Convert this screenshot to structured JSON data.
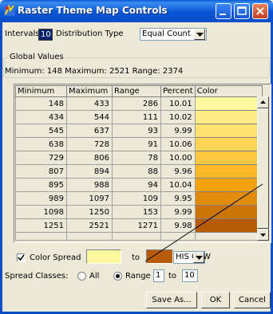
{
  "window": {
    "title": "Raster Theme Map Controls",
    "colors": {
      "titlebar": "#0a5ad6",
      "close_button": "#c3401f"
    }
  },
  "top_controls": {
    "intervals_label": "Intervals",
    "intervals_value": "10",
    "distribution_label": "Distribution Type",
    "distribution_value": "Equal Count"
  },
  "global_values": {
    "group_label": "Global Values",
    "summary": "Minimum: 148  Maximum: 2521  Range: 2374"
  },
  "table": {
    "columns": [
      "Minimum",
      "Maximum",
      "Range",
      "Percent",
      "Color"
    ],
    "rows": [
      {
        "min": "148",
        "max": "433",
        "range": "286",
        "percent": "10.01",
        "color": "#fff8a0"
      },
      {
        "min": "434",
        "max": "544",
        "range": "111",
        "percent": "10.02",
        "color": "#ffee88"
      },
      {
        "min": "545",
        "max": "637",
        "range": "93",
        "percent": "9.99",
        "color": "#ffe270"
      },
      {
        "min": "638",
        "max": "728",
        "range": "91",
        "percent": "10.06",
        "color": "#ffd558"
      },
      {
        "min": "729",
        "max": "806",
        "range": "78",
        "percent": "10.00",
        "color": "#ffc740"
      },
      {
        "min": "807",
        "max": "894",
        "range": "88",
        "percent": "9.96",
        "color": "#ffb828"
      },
      {
        "min": "895",
        "max": "988",
        "range": "94",
        "percent": "10.04",
        "color": "#f5a410"
      },
      {
        "min": "989",
        "max": "1097",
        "range": "109",
        "percent": "9.95",
        "color": "#e08c08"
      },
      {
        "min": "1098",
        "max": "1250",
        "range": "153",
        "percent": "9.99",
        "color": "#cc7406"
      },
      {
        "min": "1251",
        "max": "2521",
        "range": "1271",
        "percent": "9.98",
        "color": "#b85c04"
      }
    ]
  },
  "color_spread": {
    "label": "Color Spread",
    "checked": true,
    "from_color": "#fff8a0",
    "to_label": "to",
    "to_color": "#b85c04",
    "method": "HIS CCW"
  },
  "spread_classes": {
    "label": "Spread Classes:",
    "all_label": "All",
    "range_label": "Range",
    "range_from": "1",
    "to_label": "to",
    "range_to": "10"
  },
  "buttons": {
    "save_as": "Save As...",
    "ok": "OK",
    "cancel": "Cancel"
  }
}
